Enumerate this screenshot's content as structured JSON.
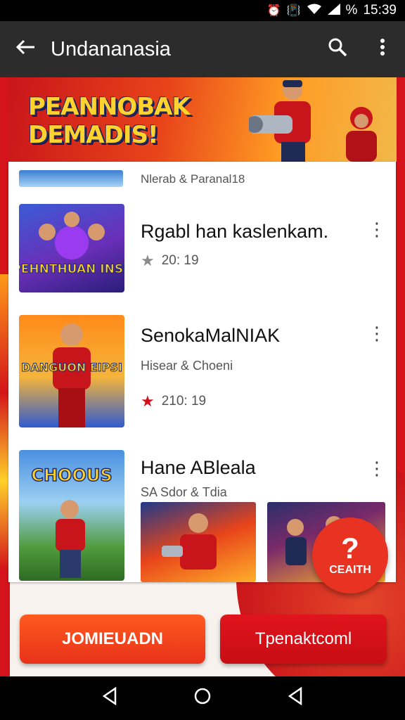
{
  "status_bar": {
    "icons": [
      "alarm-icon",
      "vibrate-icon",
      "wifi-icon",
      "signal-icon"
    ],
    "battery": "%",
    "time": "15:39"
  },
  "app_bar": {
    "title": "Undananasia",
    "back_icon": "arrow-left-icon",
    "search_icon": "search-icon",
    "more_icon": "more-vert-icon"
  },
  "banner": {
    "title": "PEANNOBAK\nDEMADIS!"
  },
  "list": {
    "partial_row": {
      "subtitle": "Nlerab & Paranal18"
    },
    "items": [
      {
        "title": "Rgabl han kaslenkam.",
        "rating": "20: 19",
        "star_color": "#8a8a8a"
      },
      {
        "title": "SenokaMalNIAK",
        "subtitle": "Hisear & Choeni",
        "rating": "210: 19",
        "star_color": "#d0121a"
      },
      {
        "title": "Hane ABleala",
        "subtitle": "SA Sdor & Tdia"
      }
    ],
    "thumb_captions": [
      "PEHNTHUAN INSE",
      "DANGUON EIPSI",
      "CHOOUS"
    ]
  },
  "fab": {
    "label": "CEAITH",
    "icon": "question-icon"
  },
  "buttons": {
    "primary": "JOMIEUADN",
    "secondary": "Tpenaktcoml"
  },
  "nav": {
    "back": "nav-back-icon",
    "home": "nav-home-icon",
    "recents": "nav-recents-icon"
  },
  "colors": {
    "accent": "#e8321a",
    "app_bar": "#2c2c2c",
    "brand_red": "#d4141a"
  }
}
